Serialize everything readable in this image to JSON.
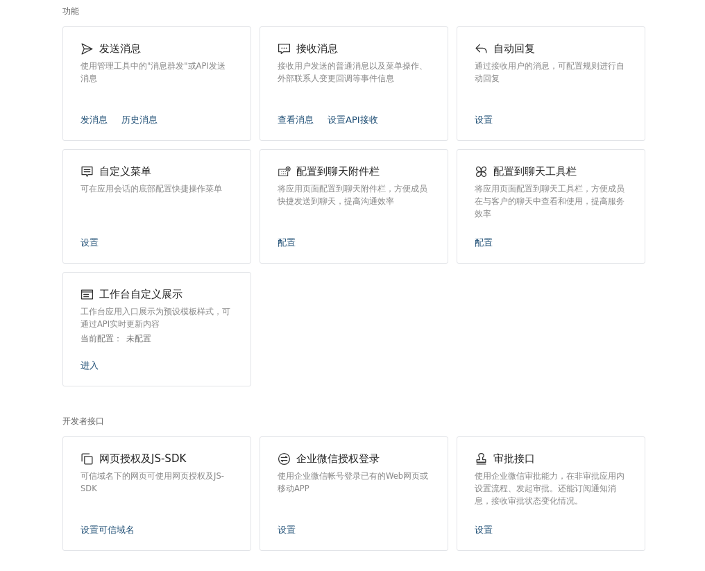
{
  "sections": [
    {
      "title": "功能",
      "cards": [
        {
          "kind": "send",
          "title": "发送消息",
          "description": "使用管理工具中的\"消息群发\"或API发送消息",
          "links": [
            "发消息",
            "历史消息"
          ]
        },
        {
          "kind": "chat",
          "title": "接收消息",
          "description": "接收用户发送的普通消息以及菜单操作、外部联系人变更回调等事件信息",
          "links": [
            "查看消息",
            "设置API接收"
          ]
        },
        {
          "kind": "reply",
          "title": "自动回复",
          "description": "通过接收用户的消息，可配置规则进行自动回复",
          "links": [
            "设置"
          ]
        },
        {
          "kind": "menu",
          "title": "自定义菜单",
          "description": "可在应用会话的底部配置快捷操作菜单",
          "links": [
            "设置"
          ]
        },
        {
          "kind": "attach",
          "title": "配置到聊天附件栏",
          "description": "将应用页面配置到聊天附件栏，方便成员快捷发送到聊天，提高沟通效率",
          "links": [
            "配置"
          ]
        },
        {
          "kind": "tools",
          "title": "配置到聊天工具栏",
          "description": "将应用页面配置到聊天工具栏，方便成员在与客户的聊天中查看和使用，提高服务效率",
          "links": [
            "配置"
          ]
        },
        {
          "kind": "workbench",
          "title": "工作台自定义展示",
          "description": "工作台应用入口展示为预设模板样式，可通过API实时更新内容",
          "status_label": "当前配置：",
          "status_value": "未配置",
          "links": [
            "进入"
          ]
        }
      ]
    },
    {
      "title": "开发者接口",
      "cards": [
        {
          "kind": "copy",
          "title": "网页授权及JS-SDK",
          "description": "可信域名下的网页可使用网页授权及JS-SDK",
          "links": [
            "设置可信域名"
          ]
        },
        {
          "kind": "login",
          "title": "企业微信授权登录",
          "description": "使用企业微信帐号登录已有的Web网页或移动APP",
          "links": [
            "设置"
          ]
        },
        {
          "kind": "stamp",
          "title": "审批接口",
          "description": "使用企业微信审批能力，在非审批应用内设置流程、发起审批。还能订阅通知消息，接收审批状态变化情况。",
          "links": [
            "设置"
          ]
        }
      ]
    }
  ]
}
